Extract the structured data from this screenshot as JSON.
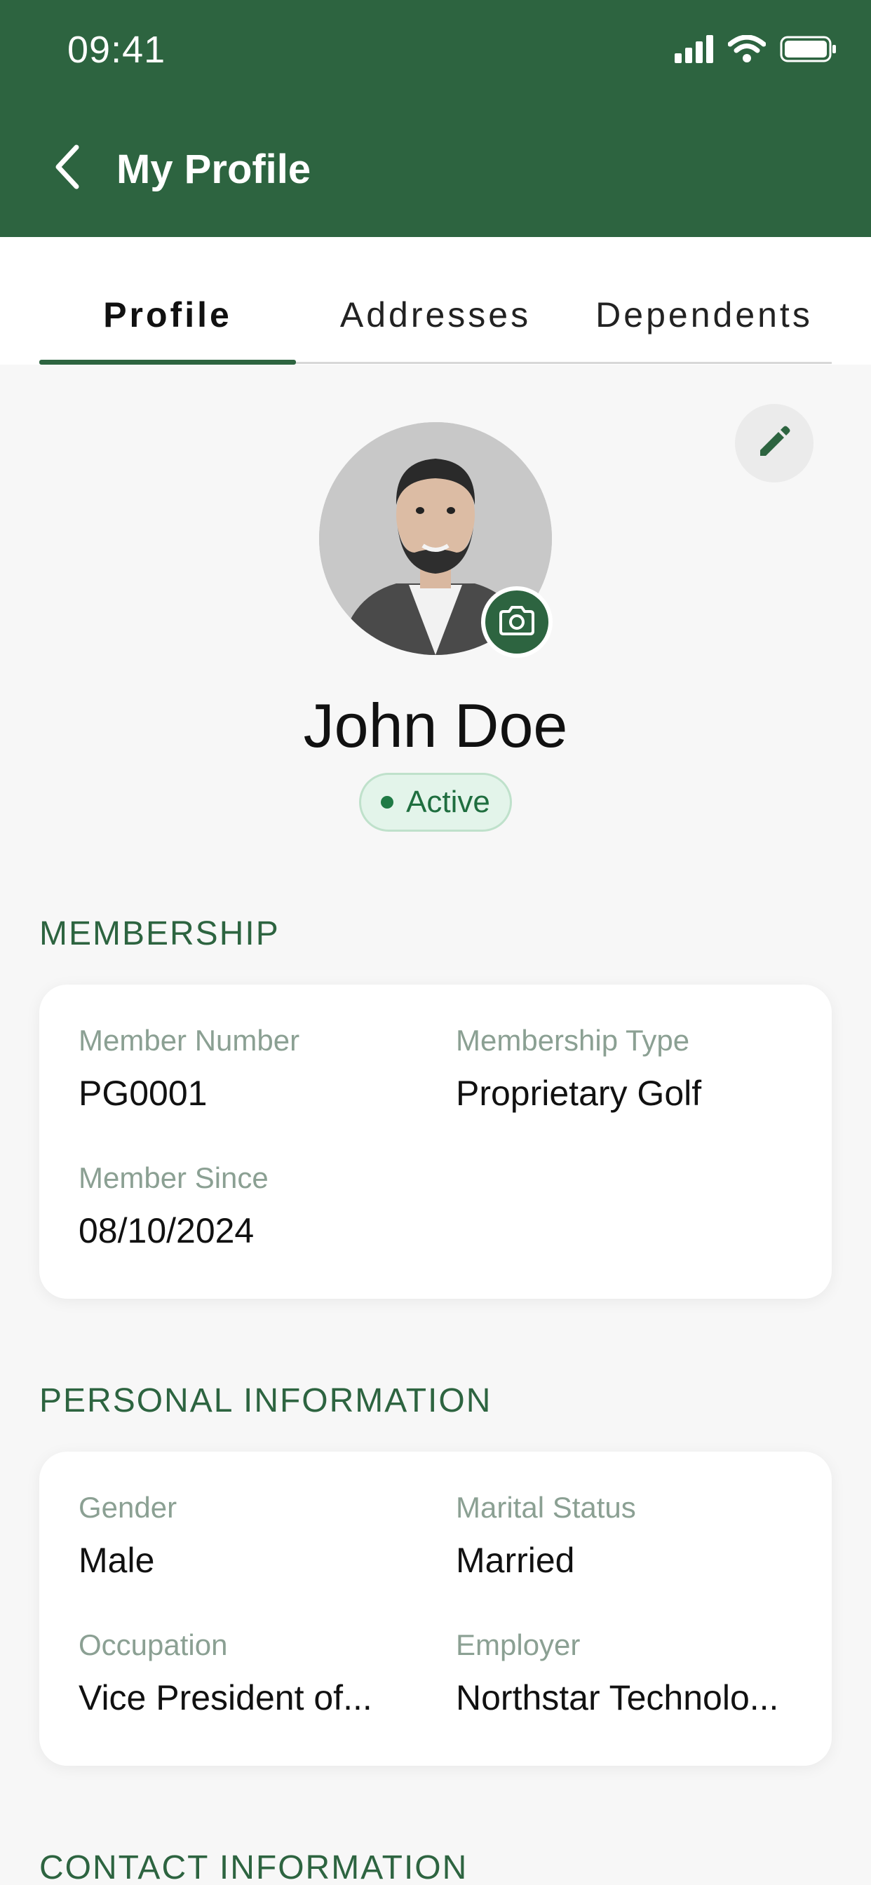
{
  "status_bar": {
    "time": "09:41"
  },
  "nav": {
    "title": "My Profile"
  },
  "tabs": [
    {
      "label": "Profile",
      "active": true
    },
    {
      "label": "Addresses",
      "active": false
    },
    {
      "label": "Dependents",
      "active": false
    }
  ],
  "profile": {
    "name": "John Doe",
    "status": "Active"
  },
  "membership": {
    "title": "MEMBERSHIP",
    "fields": [
      {
        "label": "Member Number",
        "value": "PG0001"
      },
      {
        "label": "Membership Type",
        "value": "Proprietary Golf"
      },
      {
        "label": "Member Since",
        "value": "08/10/2024"
      }
    ]
  },
  "personal": {
    "title": "PERSONAL INFORMATION",
    "fields": [
      {
        "label": "Gender",
        "value": "Male"
      },
      {
        "label": "Marital Status",
        "value": "Married"
      },
      {
        "label": "Occupation",
        "value": "Vice President of..."
      },
      {
        "label": "Employer",
        "value": "Northstar Technolo..."
      }
    ]
  },
  "contact": {
    "title": "CONTACT INFORMATION"
  },
  "icons": {
    "back": "chevron-left-icon",
    "edit": "pencil-icon",
    "camera": "camera-icon",
    "signal": "signal-icon",
    "wifi": "wifi-icon",
    "battery": "battery-icon"
  },
  "colors": {
    "brand_green": "#2d6440",
    "status_green": "#1f7a45",
    "badge_bg": "#e3f4ea",
    "label_gray": "#8ba093",
    "page_bg": "#f7f7f7"
  }
}
